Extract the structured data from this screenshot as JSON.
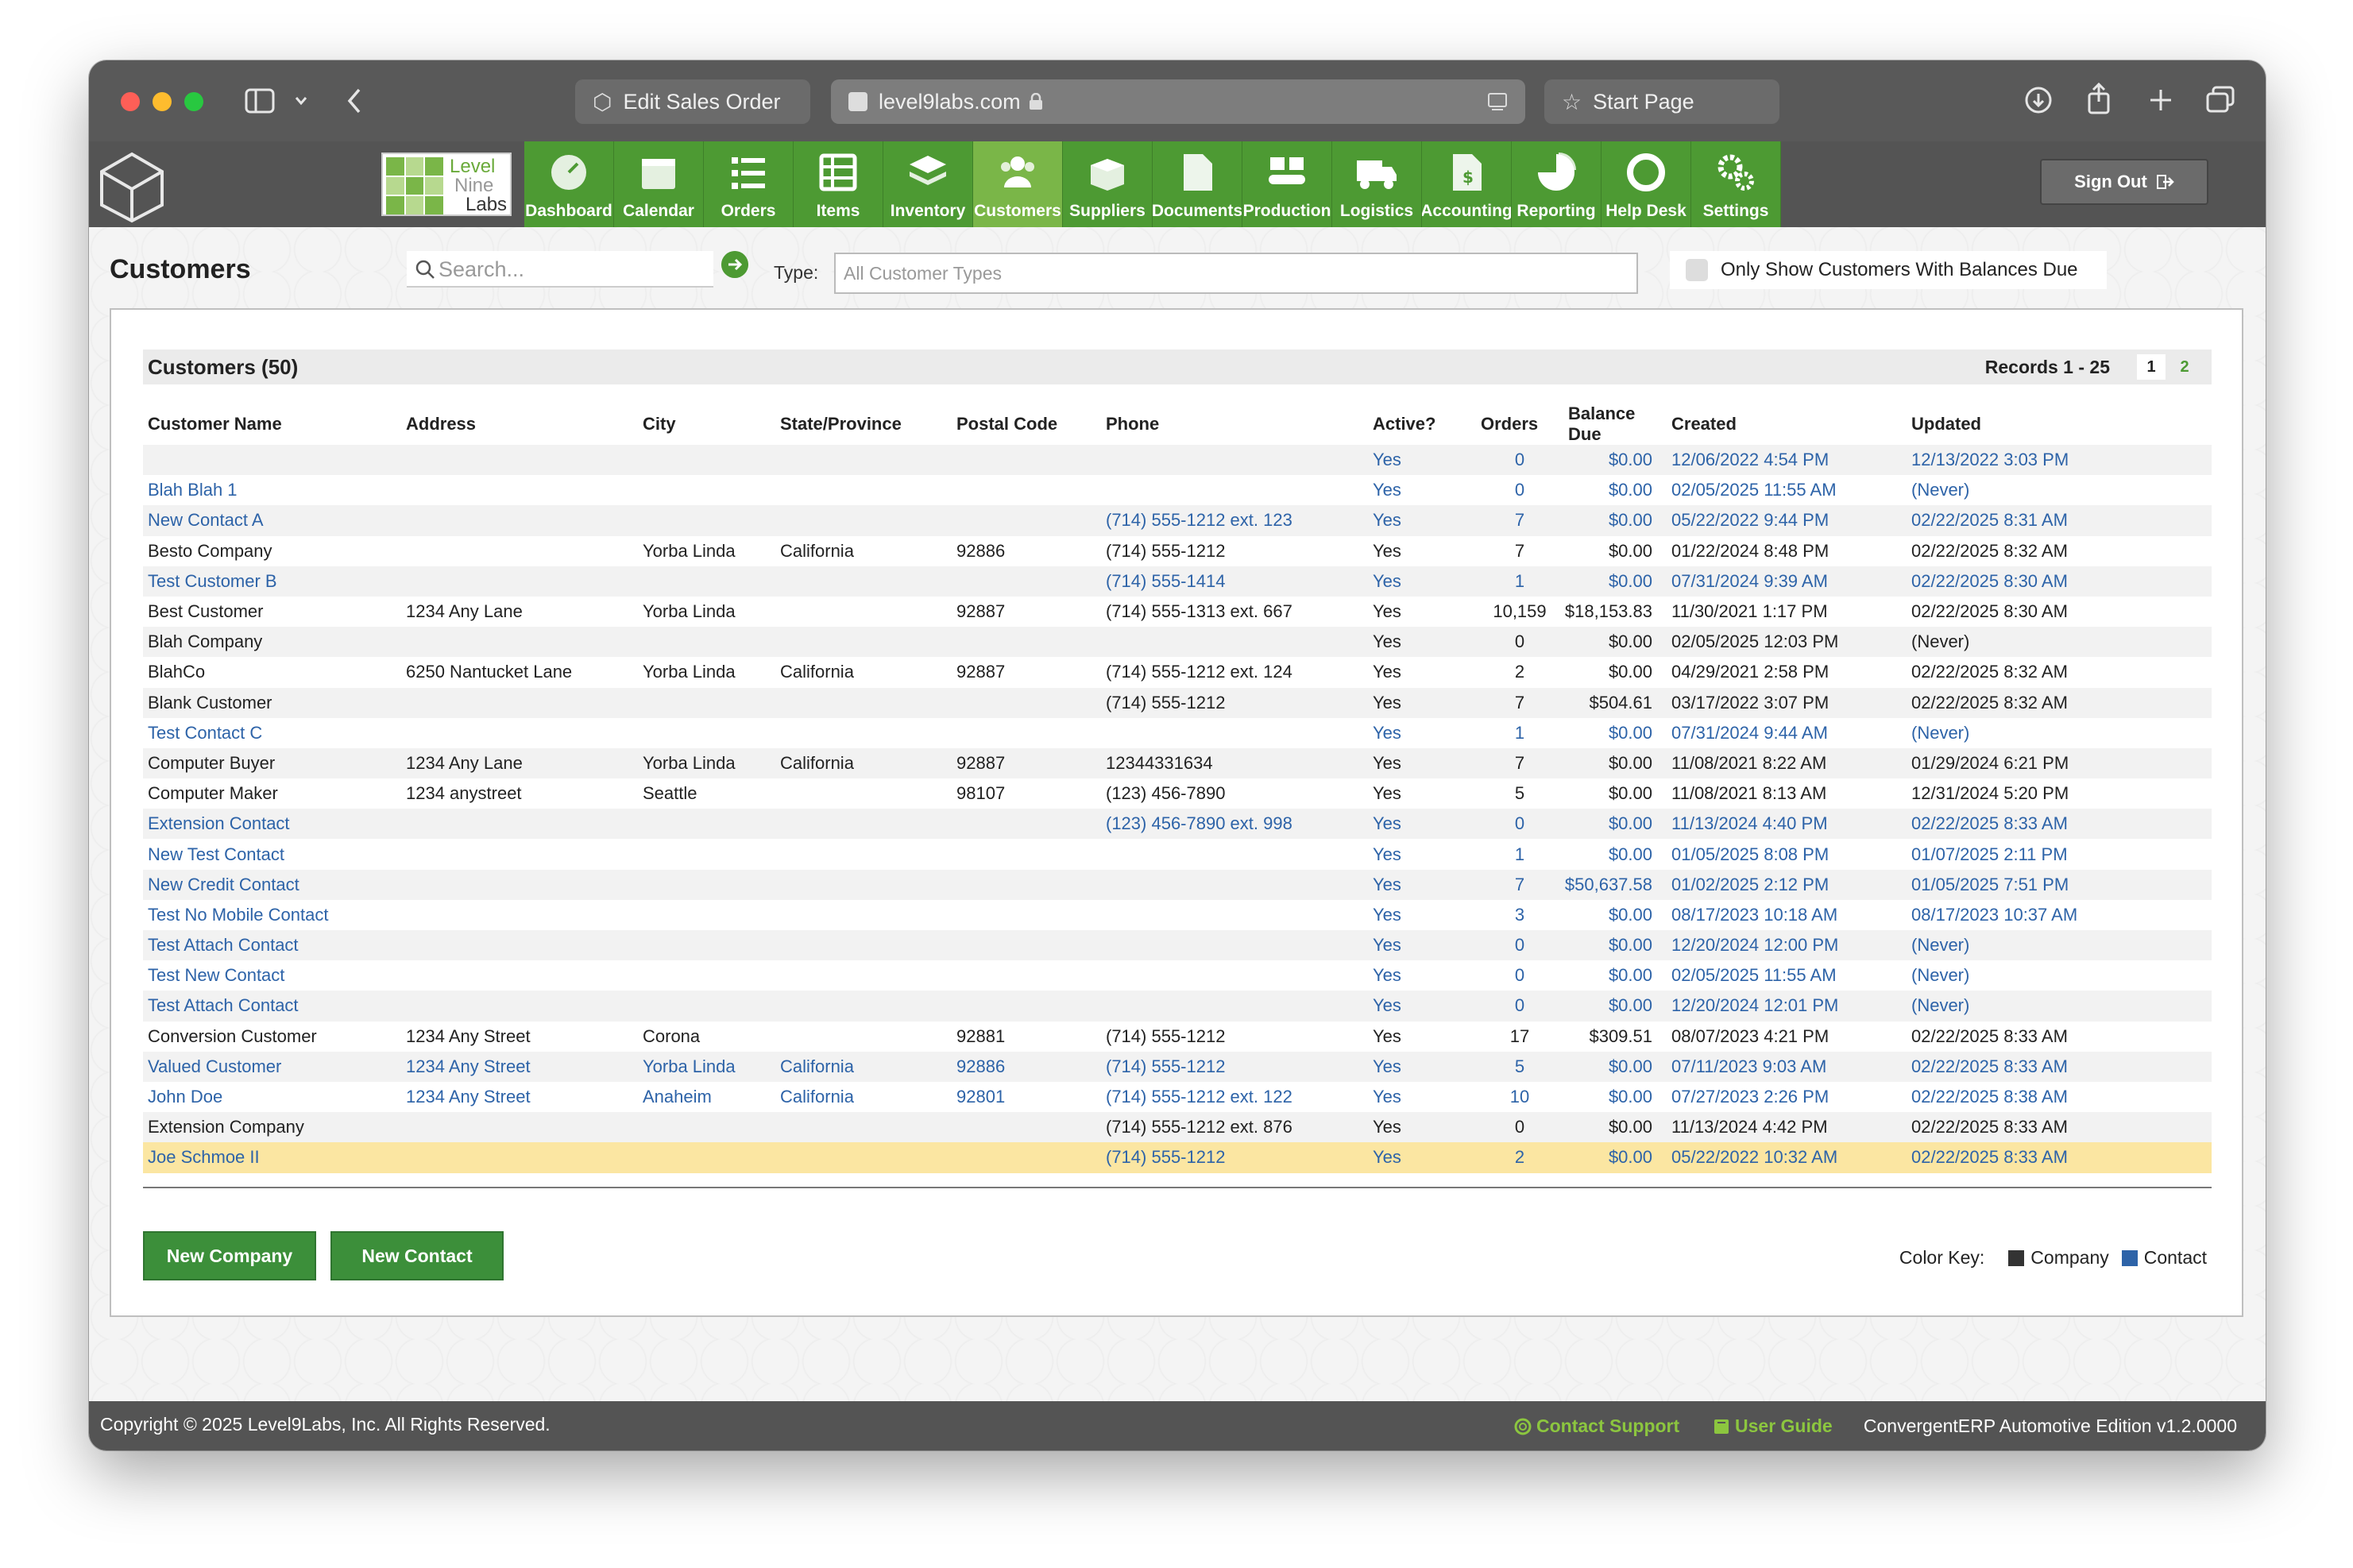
{
  "browser": {
    "tabs": [
      {
        "label": "Edit Sales Order"
      },
      {
        "label": "level9labs.com"
      },
      {
        "label": "Start Page"
      }
    ]
  },
  "brand": {
    "line1": "Level",
    "line2": "Nine",
    "line3": "Labs"
  },
  "nav": [
    {
      "label": "Dashboard",
      "icon": "dashboard-icon"
    },
    {
      "label": "Calendar",
      "icon": "calendar-icon"
    },
    {
      "label": "Orders",
      "icon": "orders-icon"
    },
    {
      "label": "Items",
      "icon": "items-icon"
    },
    {
      "label": "Inventory",
      "icon": "inventory-icon"
    },
    {
      "label": "Customers",
      "icon": "customers-icon",
      "active": true
    },
    {
      "label": "Suppliers",
      "icon": "suppliers-icon"
    },
    {
      "label": "Documents",
      "icon": "documents-icon"
    },
    {
      "label": "Production",
      "icon": "production-icon"
    },
    {
      "label": "Logistics",
      "icon": "logistics-icon"
    },
    {
      "label": "Accounting",
      "icon": "accounting-icon"
    },
    {
      "label": "Reporting",
      "icon": "reporting-icon"
    },
    {
      "label": "Help Desk",
      "icon": "help-desk-icon"
    },
    {
      "label": "Settings",
      "icon": "settings-icon"
    }
  ],
  "sign_out": "Sign Out",
  "page": {
    "title": "Customers",
    "search_placeholder": "Search...",
    "type_label": "Type:",
    "type_value": "All Customer Types",
    "balance_filter": "Only Show Customers With Balances Due"
  },
  "panel": {
    "heading": "Customers (50)",
    "records": "Records 1 - 25",
    "pages": [
      "1",
      "2"
    ]
  },
  "columns": [
    "Customer Name",
    "Address",
    "City",
    "State/Province",
    "Postal Code",
    "Phone",
    "Active?",
    "Orders",
    "Balance Due",
    "Created",
    "Updated"
  ],
  "rows": [
    {
      "type": "contact",
      "name": "",
      "address": "",
      "city": "",
      "state": "",
      "postal": "",
      "phone": "",
      "active": "Yes",
      "orders": "0",
      "balance": "$0.00",
      "created": "12/06/2022 4:54 PM",
      "updated": "12/13/2022 3:03 PM"
    },
    {
      "type": "contact",
      "name": "Blah Blah 1",
      "address": "",
      "city": "",
      "state": "",
      "postal": "",
      "phone": "",
      "active": "Yes",
      "orders": "0",
      "balance": "$0.00",
      "created": "02/05/2025 11:55 AM",
      "updated": "(Never)"
    },
    {
      "type": "contact",
      "name": "New Contact A",
      "address": "",
      "city": "",
      "state": "",
      "postal": "",
      "phone": "(714) 555-1212 ext. 123",
      "active": "Yes",
      "orders": "7",
      "balance": "$0.00",
      "created": "05/22/2022 9:44 PM",
      "updated": "02/22/2025 8:31 AM"
    },
    {
      "type": "company",
      "name": "Besto Company",
      "address": "",
      "city": "Yorba Linda",
      "state": "California",
      "postal": "92886",
      "phone": "(714) 555-1212",
      "active": "Yes",
      "orders": "7",
      "balance": "$0.00",
      "created": "01/22/2024 8:48 PM",
      "updated": "02/22/2025 8:32 AM"
    },
    {
      "type": "contact",
      "name": "Test Customer B",
      "address": "",
      "city": "",
      "state": "",
      "postal": "",
      "phone": "(714) 555-1414",
      "active": "Yes",
      "orders": "1",
      "balance": "$0.00",
      "created": "07/31/2024 9:39 AM",
      "updated": "02/22/2025 8:30 AM"
    },
    {
      "type": "company",
      "name": "Best Customer",
      "address": "1234 Any Lane",
      "city": "Yorba Linda",
      "state": "",
      "postal": "92887",
      "phone": "(714) 555-1313 ext. 667",
      "active": "Yes",
      "orders": "10,159",
      "balance": "$18,153.83",
      "created": "11/30/2021 1:17 PM",
      "updated": "02/22/2025 8:30 AM"
    },
    {
      "type": "company",
      "name": "Blah Company",
      "address": "",
      "city": "",
      "state": "",
      "postal": "",
      "phone": "",
      "active": "Yes",
      "orders": "0",
      "balance": "$0.00",
      "created": "02/05/2025 12:03 PM",
      "updated": "(Never)"
    },
    {
      "type": "company",
      "name": "BlahCo",
      "address": "6250 Nantucket Lane",
      "city": "Yorba Linda",
      "state": "California",
      "postal": "92887",
      "phone": "(714) 555-1212 ext. 124",
      "active": "Yes",
      "orders": "2",
      "balance": "$0.00",
      "created": "04/29/2021 2:58 PM",
      "updated": "02/22/2025 8:32 AM"
    },
    {
      "type": "company",
      "name": "Blank Customer",
      "address": "",
      "city": "",
      "state": "",
      "postal": "",
      "phone": "(714) 555-1212",
      "active": "Yes",
      "orders": "7",
      "balance": "$504.61",
      "created": "03/17/2022 3:07 PM",
      "updated": "02/22/2025 8:32 AM"
    },
    {
      "type": "contact",
      "name": "Test Contact C",
      "address": "",
      "city": "",
      "state": "",
      "postal": "",
      "phone": "",
      "active": "Yes",
      "orders": "1",
      "balance": "$0.00",
      "created": "07/31/2024 9:44 AM",
      "updated": "(Never)"
    },
    {
      "type": "company",
      "name": "Computer Buyer",
      "address": "1234 Any Lane",
      "city": "Yorba Linda",
      "state": "California",
      "postal": "92887",
      "phone": "12344331634",
      "active": "Yes",
      "orders": "7",
      "balance": "$0.00",
      "created": "11/08/2021 8:22 AM",
      "updated": "01/29/2024 6:21 PM"
    },
    {
      "type": "company",
      "name": "Computer Maker",
      "address": "1234 anystreet",
      "city": "Seattle",
      "state": "",
      "postal": "98107",
      "phone": "(123) 456-7890",
      "active": "Yes",
      "orders": "5",
      "balance": "$0.00",
      "created": "11/08/2021 8:13 AM",
      "updated": "12/31/2024 5:20 PM"
    },
    {
      "type": "contact",
      "name": "Extension Contact",
      "address": "",
      "city": "",
      "state": "",
      "postal": "",
      "phone": "(123) 456-7890 ext. 998",
      "active": "Yes",
      "orders": "0",
      "balance": "$0.00",
      "created": "11/13/2024 4:40 PM",
      "updated": "02/22/2025 8:33 AM"
    },
    {
      "type": "contact",
      "name": "New Test Contact",
      "address": "",
      "city": "",
      "state": "",
      "postal": "",
      "phone": "",
      "active": "Yes",
      "orders": "1",
      "balance": "$0.00",
      "created": "01/05/2025 8:08 PM",
      "updated": "01/07/2025 2:11 PM"
    },
    {
      "type": "contact",
      "name": "New Credit Contact",
      "address": "",
      "city": "",
      "state": "",
      "postal": "",
      "phone": "",
      "active": "Yes",
      "orders": "7",
      "balance": "$50,637.58",
      "created": "01/02/2025 2:12 PM",
      "updated": "01/05/2025 7:51 PM"
    },
    {
      "type": "contact",
      "name": "Test No Mobile Contact",
      "address": "",
      "city": "",
      "state": "",
      "postal": "",
      "phone": "",
      "active": "Yes",
      "orders": "3",
      "balance": "$0.00",
      "created": "08/17/2023 10:18 AM",
      "updated": "08/17/2023 10:37 AM"
    },
    {
      "type": "contact",
      "name": "Test Attach Contact",
      "address": "",
      "city": "",
      "state": "",
      "postal": "",
      "phone": "",
      "active": "Yes",
      "orders": "0",
      "balance": "$0.00",
      "created": "12/20/2024 12:00 PM",
      "updated": "(Never)"
    },
    {
      "type": "contact",
      "name": "Test New Contact",
      "address": "",
      "city": "",
      "state": "",
      "postal": "",
      "phone": "",
      "active": "Yes",
      "orders": "0",
      "balance": "$0.00",
      "created": "02/05/2025 11:55 AM",
      "updated": "(Never)"
    },
    {
      "type": "contact",
      "name": "Test Attach Contact",
      "address": "",
      "city": "",
      "state": "",
      "postal": "",
      "phone": "",
      "active": "Yes",
      "orders": "0",
      "balance": "$0.00",
      "created": "12/20/2024 12:01 PM",
      "updated": "(Never)"
    },
    {
      "type": "company",
      "name": "Conversion Customer",
      "address": "1234 Any Street",
      "city": "Corona",
      "state": "",
      "postal": "92881",
      "phone": "(714) 555-1212",
      "active": "Yes",
      "orders": "17",
      "balance": "$309.51",
      "created": "08/07/2023 4:21 PM",
      "updated": "02/22/2025 8:33 AM"
    },
    {
      "type": "contact",
      "name": "Valued Customer",
      "address": "1234 Any Street",
      "city": "Yorba Linda",
      "state": "California",
      "postal": "92886",
      "phone": "(714) 555-1212",
      "active": "Yes",
      "orders": "5",
      "balance": "$0.00",
      "created": "07/11/2023 9:03 AM",
      "updated": "02/22/2025 8:33 AM"
    },
    {
      "type": "contact",
      "name": "John Doe",
      "address": "1234 Any Street",
      "city": "Anaheim",
      "state": "California",
      "postal": "92801",
      "phone": "(714) 555-1212 ext. 122",
      "active": "Yes",
      "orders": "10",
      "balance": "$0.00",
      "created": "07/27/2023 2:26 PM",
      "updated": "02/22/2025 8:38 AM"
    },
    {
      "type": "company",
      "name": "Extension Company",
      "address": "",
      "city": "",
      "state": "",
      "postal": "",
      "phone": "(714) 555-1212 ext. 876",
      "active": "Yes",
      "orders": "0",
      "balance": "$0.00",
      "created": "11/13/2024 4:42 PM",
      "updated": "02/22/2025 8:33 AM"
    },
    {
      "type": "contact",
      "name": "Joe Schmoe II",
      "address": "",
      "city": "",
      "state": "",
      "postal": "",
      "phone": "(714) 555-1212",
      "active": "Yes",
      "orders": "2",
      "balance": "$0.00",
      "created": "05/22/2022 10:32 AM",
      "updated": "02/22/2025 8:33 AM",
      "highlighted": true
    }
  ],
  "buttons": {
    "new_company": "New Company",
    "new_contact": "New Contact"
  },
  "color_key": {
    "label": "Color Key:",
    "company": "Company",
    "contact": "Contact",
    "company_color": "#333333",
    "contact_color": "#2d63a8"
  },
  "footer": {
    "copyright": "Copyright © 2025 Level9Labs, Inc. All Rights Reserved.",
    "contact_support": "Contact Support",
    "user_guide": "User Guide",
    "version": "ConvergentERP Automotive Edition v1.2.0000"
  },
  "colors": {
    "nav_green": "#4d9a33",
    "nav_active": "#7ab648",
    "link_blue": "#2d63a8",
    "highlight": "#fbe6a2"
  }
}
